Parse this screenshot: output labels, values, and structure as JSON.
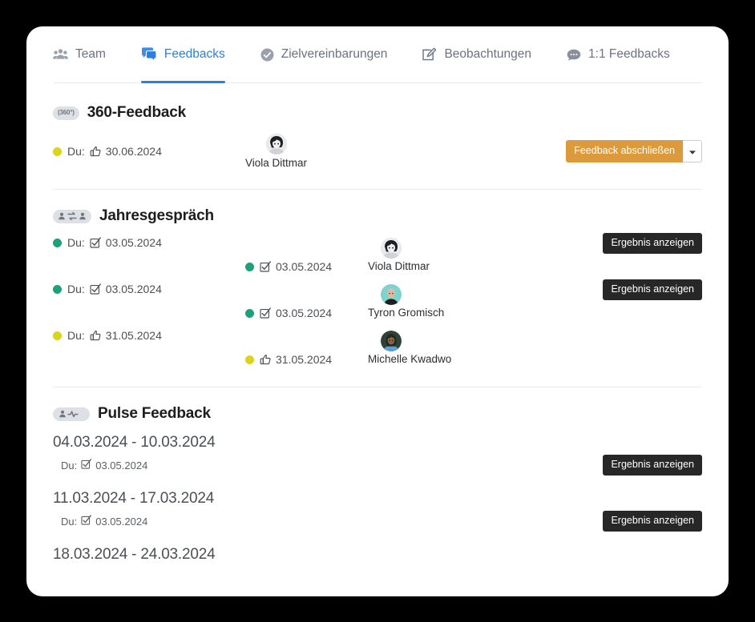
{
  "tabs": [
    {
      "label": "Team",
      "icon": "people-group-icon",
      "active": false
    },
    {
      "label": "Feedbacks",
      "icon": "chat-bubble-icon",
      "active": true
    },
    {
      "label": "Zielvereinbarungen",
      "icon": "check-circle-icon",
      "active": false
    },
    {
      "label": "Beobachtungen",
      "icon": "pencil-square-icon",
      "active": false
    },
    {
      "label": "1:1 Feedbacks",
      "icon": "speech-bubble-dots-icon",
      "active": false
    }
  ],
  "colors": {
    "accent": "#2b7fe0",
    "status_green": "#1fa07c",
    "status_yellow": "#d9d41c",
    "button_dark": "#272727",
    "button_orange": "#dd9a3c",
    "card_bg": "#ffffff",
    "page_bg": "#000000"
  },
  "sections": [
    {
      "id": "360-feedback",
      "title": "360-Feedback",
      "badge_text": "360°",
      "badge_icon": "360-badge-icon",
      "rows": [
        {
          "self": {
            "prefix": "Du:",
            "status": "yellow",
            "icon": "thumbs-up-icon",
            "date": "30.06.2024"
          },
          "person": {
            "name": "Viola Dittmar",
            "avatar": "avatar-viola-dittmar"
          },
          "button": {
            "label": "Feedback abschließen",
            "style": "orange",
            "has_caret": true,
            "caret_icon": "chevron-down-icon"
          }
        }
      ]
    },
    {
      "id": "jahresgespraech",
      "title": "Jahresgespräch",
      "badge_icon": "two-persons-exchange-icon",
      "rows": [
        {
          "self": {
            "prefix": "Du:",
            "status": "green",
            "icon": "checkbox-checked-icon",
            "date": "03.05.2024"
          },
          "peer": {
            "status": "green",
            "icon": "checkbox-checked-icon",
            "date": "03.05.2024"
          },
          "person": {
            "name": "Viola Dittmar",
            "avatar": "avatar-viola-dittmar"
          },
          "button": {
            "label": "Ergebnis anzeigen",
            "style": "dark"
          }
        },
        {
          "self": {
            "prefix": "Du:",
            "status": "green",
            "icon": "checkbox-checked-icon",
            "date": "03.05.2024"
          },
          "peer": {
            "status": "green",
            "icon": "checkbox-checked-icon",
            "date": "03.05.2024"
          },
          "person": {
            "name": "Tyron Gromisch",
            "avatar": "avatar-tyron-gromisch"
          },
          "button": {
            "label": "Ergebnis anzeigen",
            "style": "dark"
          }
        },
        {
          "self": {
            "prefix": "Du:",
            "status": "yellow",
            "icon": "thumbs-up-icon",
            "date": "31.05.2024"
          },
          "peer": {
            "status": "yellow",
            "icon": "thumbs-up-icon",
            "date": "31.05.2024"
          },
          "person": {
            "name": "Michelle Kwadwo",
            "avatar": "avatar-michelle-kwadwo"
          },
          "button": null
        }
      ]
    },
    {
      "id": "pulse-feedback",
      "title": "Pulse Feedback",
      "badge_icon": "person-pulse-icon",
      "periods": [
        {
          "range": "04.03.2024 - 10.03.2024",
          "entry": {
            "prefix": "Du:",
            "icon": "checkbox-checked-icon",
            "date": "03.05.2024"
          },
          "button": {
            "label": "Ergebnis anzeigen",
            "style": "dark"
          }
        },
        {
          "range": "11.03.2024 - 17.03.2024",
          "entry": {
            "prefix": "Du:",
            "icon": "checkbox-checked-icon",
            "date": "03.05.2024"
          },
          "button": {
            "label": "Ergebnis anzeigen",
            "style": "dark"
          }
        },
        {
          "range": "18.03.2024 - 24.03.2024",
          "entry": null,
          "button": null
        }
      ]
    }
  ]
}
